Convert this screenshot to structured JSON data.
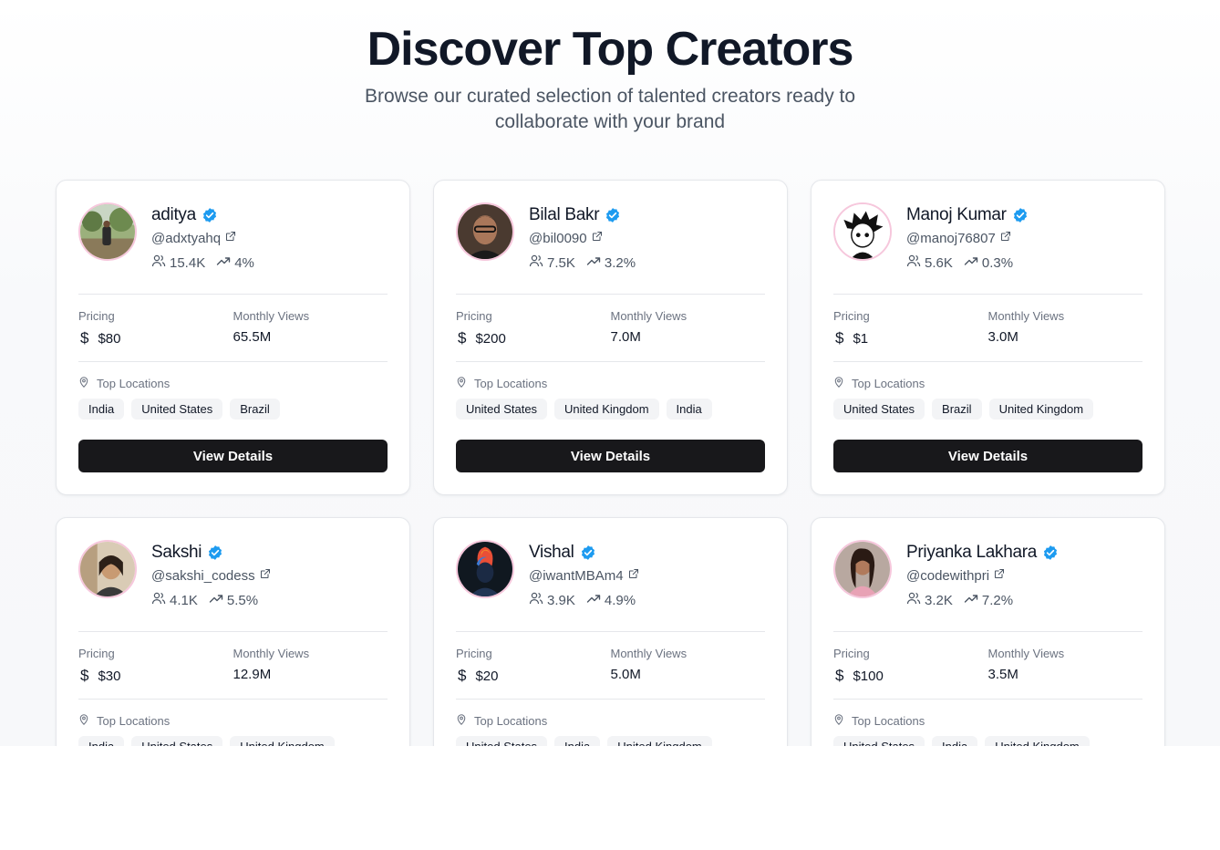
{
  "hero": {
    "title": "Discover Top Creators",
    "subtitle": "Browse our curated selection of talented creators ready to collaborate with your brand"
  },
  "labels": {
    "pricing": "Pricing",
    "monthly_views": "Monthly Views",
    "top_locations": "Top Locations",
    "view_details": "View Details"
  },
  "colors": {
    "accent": "#18181b",
    "verified": "#1d9bf0",
    "avatar_ring": "#f6c7dc"
  },
  "creators": [
    {
      "name": "aditya",
      "handle": "@adxtyahq",
      "followers": "15.4K",
      "engagement": "4%",
      "price": "$80",
      "views": "65.5M",
      "locations": [
        "India",
        "United States",
        "Brazil"
      ]
    },
    {
      "name": "Bilal Bakr",
      "handle": "@bil0090",
      "followers": "7.5K",
      "engagement": "3.2%",
      "price": "$200",
      "views": "7.0M",
      "locations": [
        "United States",
        "United Kingdom",
        "India"
      ]
    },
    {
      "name": "Manoj Kumar",
      "handle": "@manoj76807",
      "followers": "5.6K",
      "engagement": "0.3%",
      "price": "$1",
      "views": "3.0M",
      "locations": [
        "United States",
        "Brazil",
        "United Kingdom"
      ]
    },
    {
      "name": "Sakshi",
      "handle": "@sakshi_codess",
      "followers": "4.1K",
      "engagement": "5.5%",
      "price": "$30",
      "views": "12.9M",
      "locations": [
        "India",
        "United States",
        "United Kingdom"
      ]
    },
    {
      "name": "Vishal",
      "handle": "@iwantMBAm4",
      "followers": "3.9K",
      "engagement": "4.9%",
      "price": "$20",
      "views": "5.0M",
      "locations": [
        "United States",
        "India",
        "United Kingdom"
      ]
    },
    {
      "name": "Priyanka Lakhara",
      "handle": "@codewithpri",
      "followers": "3.2K",
      "engagement": "7.2%",
      "price": "$100",
      "views": "3.5M",
      "locations": [
        "United States",
        "India",
        "United Kingdom"
      ]
    }
  ]
}
